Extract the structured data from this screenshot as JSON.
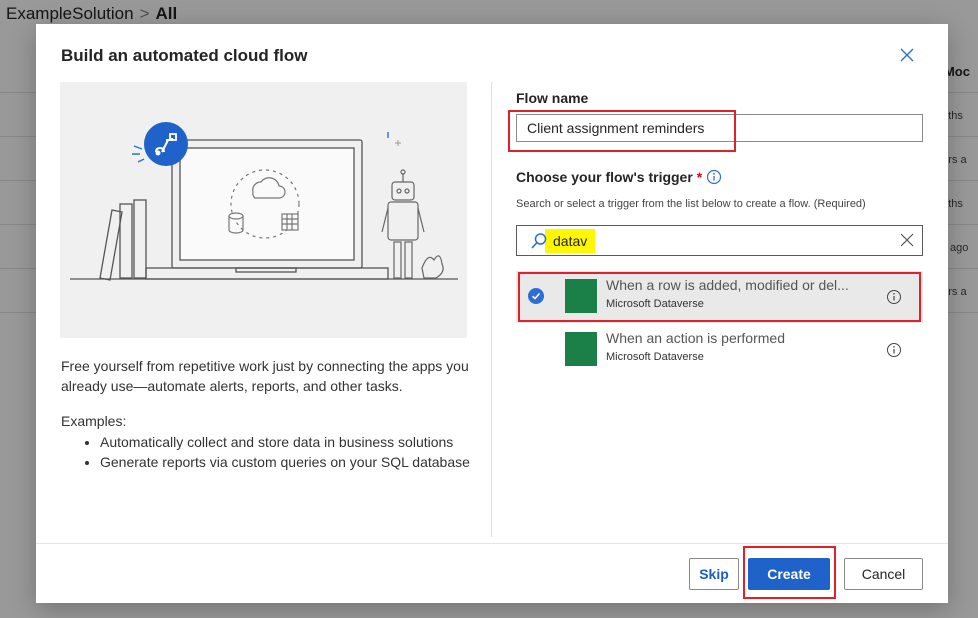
{
  "background": {
    "breadcrumb": {
      "solution": "ExampleSolution",
      "separator": ">",
      "current": "All"
    },
    "right_column_header": ": Moc",
    "right_column_cells": [
      "onths",
      "ours a",
      "onths",
      "ys ago",
      "ours a"
    ]
  },
  "dialog": {
    "title": "Build an automated cloud flow",
    "close_icon": "close-icon",
    "description": "Free yourself from repetitive work just by connecting the apps you already use—automate alerts, reports, and other tasks.",
    "examples_label": "Examples:",
    "examples": [
      "Automatically collect and store data in business solutions",
      "Generate reports via custom queries on your SQL database"
    ],
    "flow_name": {
      "label": "Flow name",
      "value": "Client assignment reminders"
    },
    "trigger": {
      "label": "Choose your flow's trigger",
      "required_mark": "*",
      "help": "Search or select a trigger from the list below to create a flow. (Required)",
      "search_value": "datav",
      "items": [
        {
          "title": "When a row is added, modified or del...",
          "connector": "Microsoft Dataverse",
          "selected": true
        },
        {
          "title": "When an action is performed",
          "connector": "Microsoft Dataverse",
          "selected": false
        }
      ]
    },
    "buttons": {
      "skip": "Skip",
      "create": "Create",
      "cancel": "Cancel"
    }
  },
  "colors": {
    "accent": "#1f62c9",
    "highlight_red": "#e0202a",
    "search_highlight": "#fff700",
    "dataverse_green": "#1a8047"
  }
}
